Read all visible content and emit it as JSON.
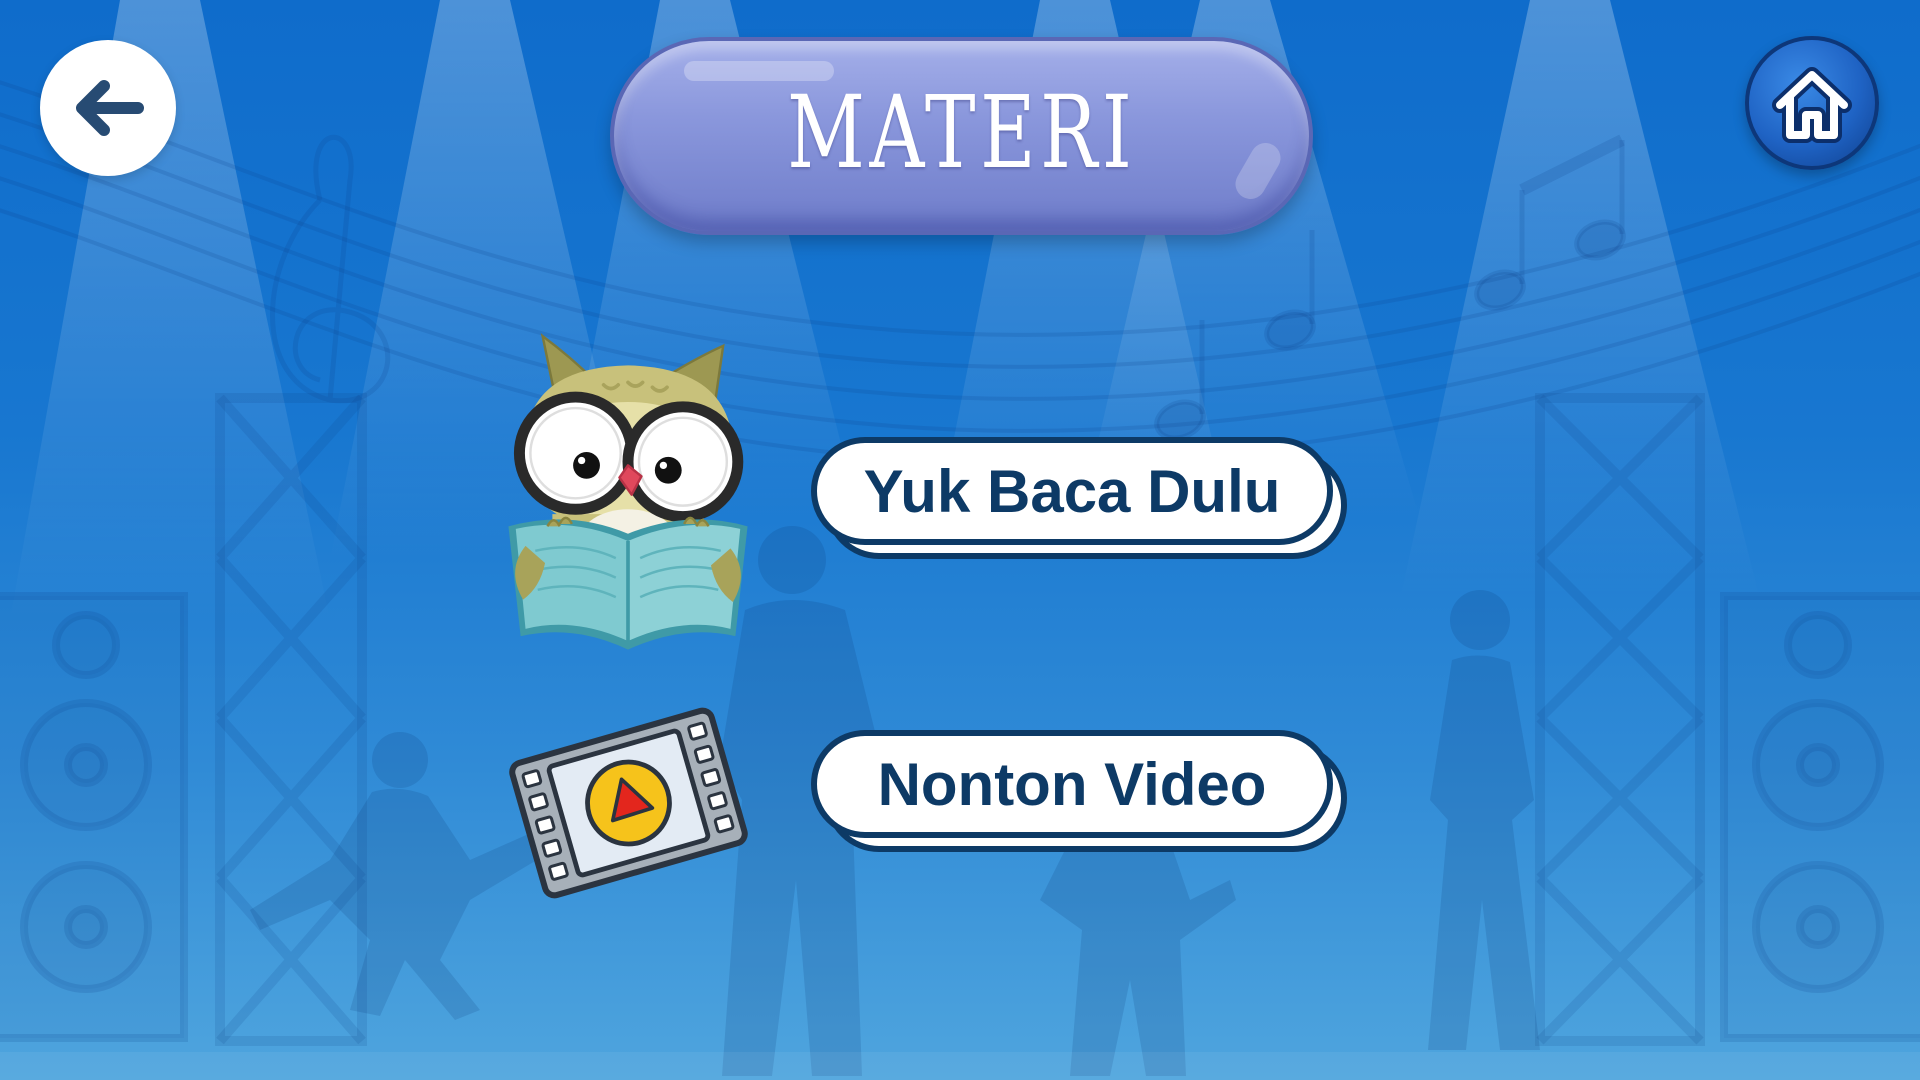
{
  "header": {
    "title": "MATERI",
    "back_icon": "arrow-left-icon",
    "home_icon": "home-icon"
  },
  "menu": {
    "items": [
      {
        "label": "Yuk Baca Dulu",
        "icon": "owl-reading-book-icon"
      },
      {
        "label": "Nonton Video",
        "icon": "film-play-icon"
      }
    ]
  },
  "colors": {
    "background_top": "#0f6ccb",
    "background_bottom": "#4fa5de",
    "title_pill": "#7b88d4",
    "title_text": "#ffffff",
    "button_fill": "#ffffff",
    "button_border": "#0d3a66",
    "button_text": "#0d3a66",
    "home_button": "#1f63c4",
    "back_button": "#ffffff",
    "back_arrow": "#274b73"
  }
}
